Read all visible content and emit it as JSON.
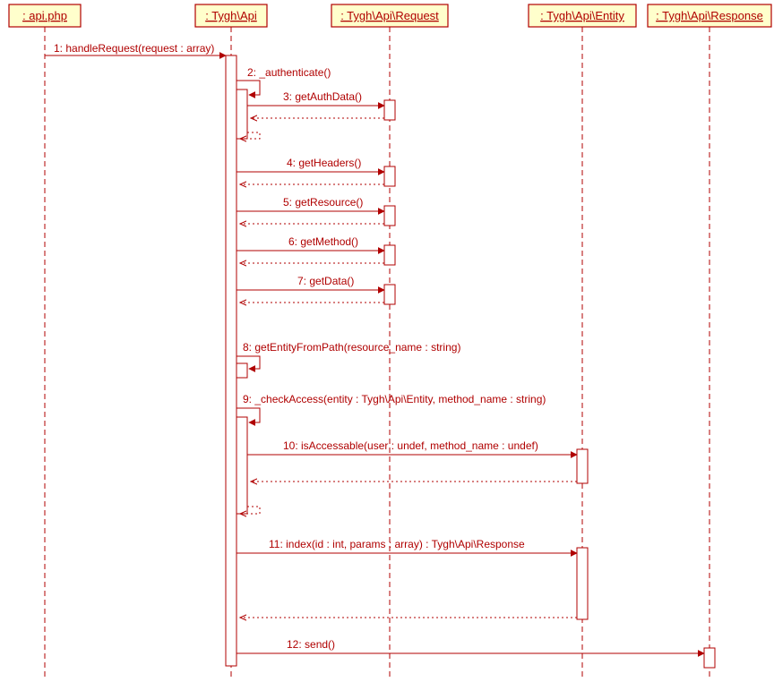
{
  "participants": {
    "p0": ": api.php",
    "p1": ": Tygh\\Api",
    "p2": ": Tygh\\Api\\Request",
    "p3": ": Tygh\\Api\\Entity",
    "p4": ": Tygh\\Api\\Response"
  },
  "messages": {
    "m1": "1: handleRequest(request : array)",
    "m2": "2: _authenticate()",
    "m3": "3: getAuthData()",
    "m4": "4: getHeaders()",
    "m5": "5: getResource()",
    "m6": "6: getMethod()",
    "m7": "7: getData()",
    "m8": "8: getEntityFromPath(resource_name : string)",
    "m9": "9: _checkAccess(entity : Tygh\\Api\\Entity, method_name : string)",
    "m10": "10: isAccessable(user : undef, method_name : undef)",
    "m11": "11: index(id : int, params : array) : Tygh\\Api\\Response",
    "m12": "12: send()"
  },
  "chart_data": {
    "type": "uml-sequence-diagram",
    "participants": [
      ": api.php",
      ": Tygh\\Api",
      ": Tygh\\Api\\Request",
      ": Tygh\\Api\\Entity",
      ": Tygh\\Api\\Response"
    ],
    "calls": [
      {
        "n": 1,
        "from": ": api.php",
        "to": ": Tygh\\Api",
        "label": "handleRequest(request : array)"
      },
      {
        "n": 2,
        "from": ": Tygh\\Api",
        "to": ": Tygh\\Api",
        "label": "_authenticate()"
      },
      {
        "n": 3,
        "from": ": Tygh\\Api",
        "to": ": Tygh\\Api\\Request",
        "label": "getAuthData()"
      },
      {
        "n": 4,
        "from": ": Tygh\\Api",
        "to": ": Tygh\\Api\\Request",
        "label": "getHeaders()"
      },
      {
        "n": 5,
        "from": ": Tygh\\Api",
        "to": ": Tygh\\Api\\Request",
        "label": "getResource()"
      },
      {
        "n": 6,
        "from": ": Tygh\\Api",
        "to": ": Tygh\\Api\\Request",
        "label": "getMethod()"
      },
      {
        "n": 7,
        "from": ": Tygh\\Api",
        "to": ": Tygh\\Api\\Request",
        "label": "getData()"
      },
      {
        "n": 8,
        "from": ": Tygh\\Api",
        "to": ": Tygh\\Api",
        "label": "getEntityFromPath(resource_name : string)"
      },
      {
        "n": 9,
        "from": ": Tygh\\Api",
        "to": ": Tygh\\Api",
        "label": "_checkAccess(entity : Tygh\\Api\\Entity, method_name : string)"
      },
      {
        "n": 10,
        "from": ": Tygh\\Api",
        "to": ": Tygh\\Api\\Entity",
        "label": "isAccessable(user : undef, method_name : undef)"
      },
      {
        "n": 11,
        "from": ": Tygh\\Api",
        "to": ": Tygh\\Api\\Entity",
        "label": "index(id : int, params : array) : Tygh\\Api\\Response"
      },
      {
        "n": 12,
        "from": ": Tygh\\Api",
        "to": ": Tygh\\Api\\Response",
        "label": "send()"
      }
    ]
  }
}
